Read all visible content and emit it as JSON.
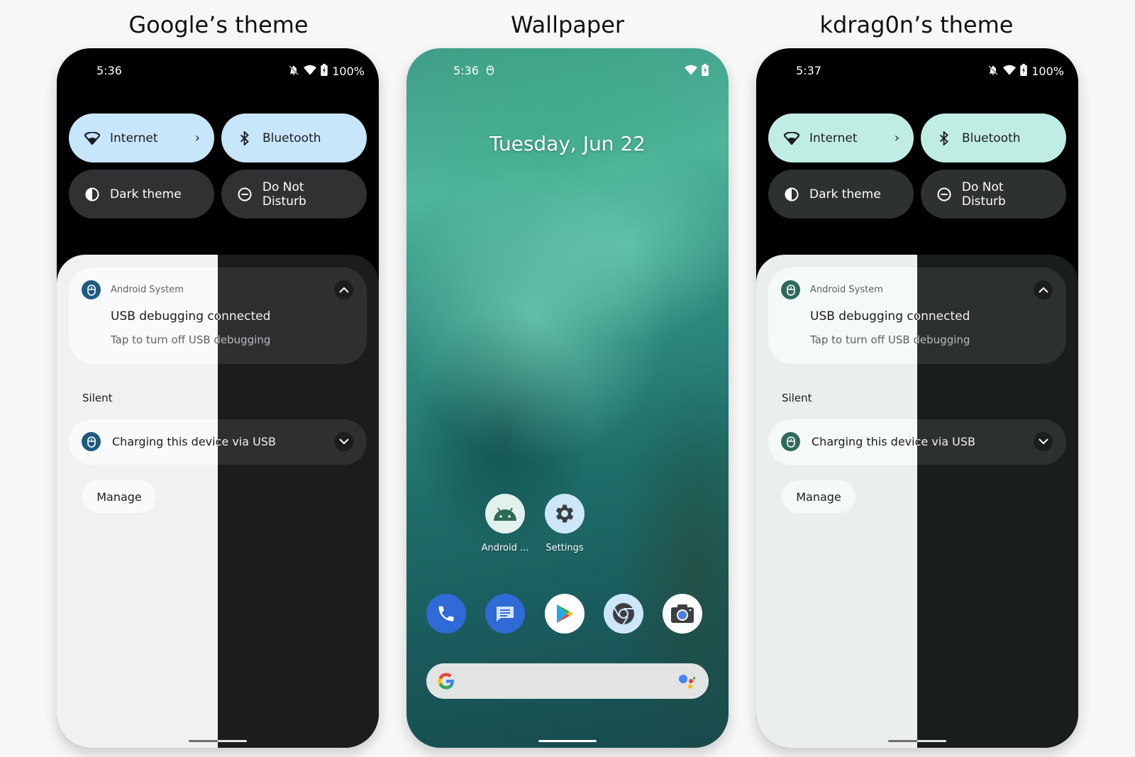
{
  "titles": {
    "left": "Google’s theme",
    "middle": "Wallpaper",
    "right": "kdrag0n’s theme"
  },
  "phones": {
    "google": {
      "time": "5:36",
      "battery": "100%",
      "accent": "#c7e6fb",
      "accent_icon": "#1f5a80",
      "shade_light": "#f0f1f3",
      "shade_dark": "#1b1c1e",
      "card_light": "#f8fafb",
      "card_dark": "#2e2f31"
    },
    "kdrag0n": {
      "time": "5:37",
      "battery": "100%",
      "accent": "#c0ede3",
      "accent_icon": "#2f6a5c",
      "shade_light": "#eaefed",
      "shade_dark": "#191d1c",
      "card_light": "#f5faf8",
      "card_dark": "#2c302f"
    }
  },
  "quick_settings": {
    "tiles": [
      "Internet",
      "Bluetooth",
      "Dark theme",
      "Do Not Disturb"
    ]
  },
  "notifications": {
    "app_name": "Android System",
    "title": "USB debugging connected",
    "body": "Tap to turn off USB debugging",
    "section_label": "Silent",
    "silent_item": "Charging this device via USB",
    "manage_label": "Manage"
  },
  "wallpaper_screen": {
    "time": "5:36",
    "date": "Tuesday, Jun 22",
    "apps": [
      {
        "label": "Android ...",
        "icon": "android-icon"
      },
      {
        "label": "Settings",
        "icon": "settings-gear-icon"
      }
    ],
    "dock": [
      "phone-icon",
      "messages-icon",
      "play-store-icon",
      "chrome-icon",
      "camera-icon"
    ]
  }
}
